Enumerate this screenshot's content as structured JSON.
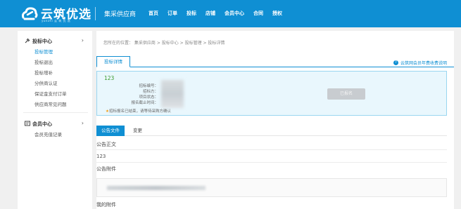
{
  "header": {
    "logo_text": "云筑优选",
    "logo_sub": "yunzhi 云 筑 优 选",
    "supplier_label": "集采供应商",
    "nav": [
      "首页",
      "订单",
      "投标",
      "店铺",
      "会员中心",
      "合同",
      "授权"
    ],
    "brand_color": "#0f8fd3"
  },
  "sidebar": {
    "group1": {
      "icon": "gavel-icon",
      "label": "投标中心"
    },
    "items": [
      "投标管理",
      "投标退出",
      "投标增补",
      "分供商认证",
      "保证金支付订单",
      "供应商常见问题"
    ],
    "active_index": 0,
    "group2": {
      "icon": "member-card-icon",
      "label": "会员中心"
    },
    "items2": [
      "会员充值记录"
    ]
  },
  "main": {
    "breadcrumb": "您所在的位置： 集采供应商 > 投标中心 > 投标管理 > 投标详情",
    "tab_title": "投标详情",
    "help_text": "云筑网会员年费收费说明",
    "info": {
      "title": "123",
      "labels": [
        "招标编号：",
        "招标方：",
        "项目状态：",
        "报名截止时间："
      ],
      "note": "招标报名已结束，请等待采购方确认",
      "button": "已报名"
    },
    "tabs": [
      "公告文件",
      "变更"
    ],
    "section1_title": "公告正文",
    "section1_text": "123",
    "section2_title": "公告附件",
    "section3_title": "我的附件"
  }
}
